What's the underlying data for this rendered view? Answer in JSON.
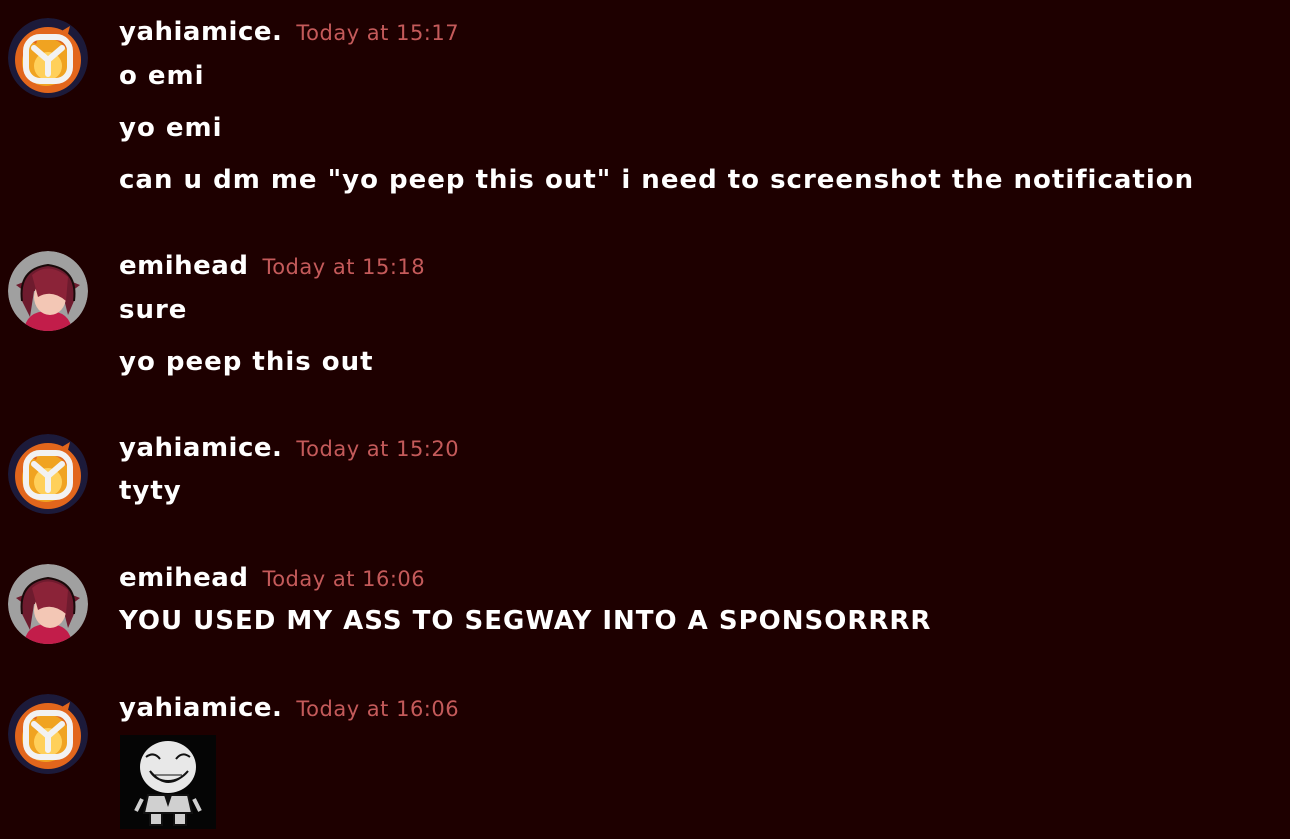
{
  "users": {
    "yahiamice": "yahiamice.",
    "emihead": "emihead"
  },
  "colors": {
    "background": "#1e0000",
    "username": "#ffffff",
    "timestamp": "#c45a5a",
    "message": "#ffffff"
  },
  "messages": [
    {
      "author": "yahiamice.",
      "avatar": "yahiamice-logo-icon",
      "timestamp": "Today at 15:17",
      "lines": [
        "o emi",
        "yo emi",
        "can u dm me \"yo peep this out\" i need to screenshot the notification"
      ]
    },
    {
      "author": "emihead",
      "avatar": "emihead-character-icon",
      "timestamp": "Today at 15:18",
      "lines": [
        "sure",
        "yo peep this out"
      ]
    },
    {
      "author": "yahiamice.",
      "avatar": "yahiamice-logo-icon",
      "timestamp": "Today at 15:20",
      "lines": [
        "tyty"
      ]
    },
    {
      "author": "emihead",
      "avatar": "emihead-character-icon",
      "timestamp": "Today at 16:06",
      "lines": [
        "YOU USED MY ASS TO SEGWAY INTO A SPONSORRRR"
      ]
    },
    {
      "author": "yahiamice.",
      "avatar": "yahiamice-logo-icon",
      "timestamp": "Today at 16:06",
      "lines": [],
      "attachment": "trollface-image"
    }
  ]
}
